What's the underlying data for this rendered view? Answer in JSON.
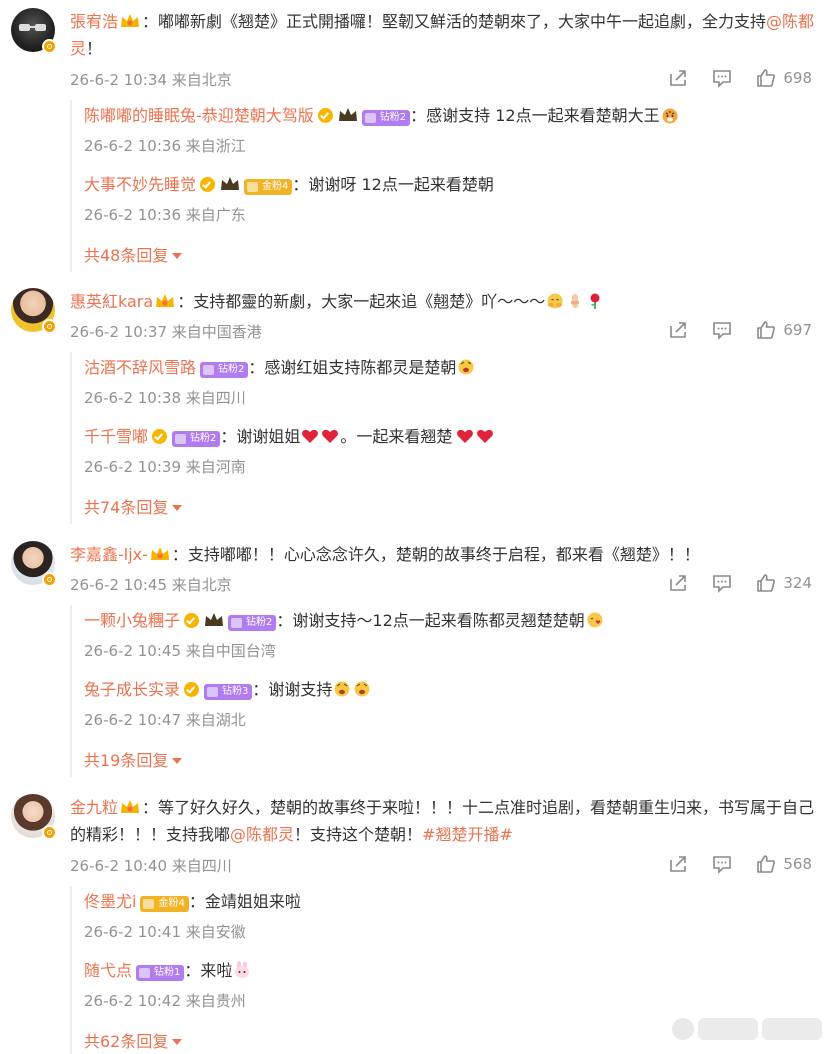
{
  "comments": [
    {
      "user": "張宥浩",
      "text_parts": [
        "：嘟嘟新劇《翘楚》正式開播囉！堅韌又鮮活的楚朝來了，大家中午一起追劇，全力支持",
        "@陈都灵",
        "！"
      ],
      "meta": "26-6-2 10:34 来自北京",
      "likes": "698",
      "replies": [
        {
          "user": "陈嘟嘟的睡眠兔-恭迎楚朝大驾版",
          "badge": "钻粉2",
          "text": "：感谢支持 12点一起来看楚朝大王",
          "meta": "26-6-2 10:36 来自浙江"
        },
        {
          "user": "大事不妙先睡觉",
          "badge": "金粉4",
          "text": "：谢谢呀 12点一起来看楚朝",
          "meta": "26-6-2 10:36 来自广东"
        }
      ],
      "more": "共48条回复"
    },
    {
      "user": "惠英紅kara",
      "text": "：支持都靈的新劇，大家一起來追《翹楚》吖～～～",
      "meta": "26-6-2 10:37 来自中国香港",
      "likes": "697",
      "replies": [
        {
          "user": "沽酒不辞风雪路",
          "badge": "钻粉2",
          "text": "：感谢红姐支持陈都灵是楚朝",
          "meta": "26-6-2 10:38 来自四川"
        },
        {
          "user": "千千雪嘟",
          "badge": "钻粉2",
          "text_a": "：谢谢姐姐",
          "text_b": "。一起来看翘楚",
          "meta": "26-6-2 10:39 来自河南"
        }
      ],
      "more": "共74条回复"
    },
    {
      "user": "李嘉鑫-ljx-",
      "text": "：支持嘟嘟！！心心念念许久，楚朝的故事终于启程，都来看《翘楚》！！",
      "meta": "26-6-2 10:45 来自北京",
      "likes": "324",
      "replies": [
        {
          "user": "一颗小兔糰子",
          "badge": "钻粉2",
          "text": "：谢谢支持～12点一起来看陈都灵翘楚楚朝",
          "meta": "26-6-2 10:45 来自中国台湾"
        },
        {
          "user": "兔子成长实录",
          "badge": "钻粉3",
          "text": "：谢谢支持",
          "meta": "26-6-2 10:47 来自湖北"
        }
      ],
      "more": "共19条回复"
    },
    {
      "user": "金九粒",
      "text_parts": [
        "：等了好久好久，楚朝的故事终于来啦！！！十二点准时追剧，看楚朝重生归来，书写属于自己的精彩！！！支持我嘟",
        "@陈都灵",
        "！支持这个楚朝！",
        "#翘楚开播#"
      ],
      "meta": "26-6-2 10:40 来自四川",
      "likes": "568",
      "replies": [
        {
          "user": "佟墨尤i",
          "badge": "金粉4",
          "text": "：金靖姐姐来啦",
          "meta": "26-6-2 10:41 来自安徽"
        },
        {
          "user": "随弋点",
          "badge": "钻粉1",
          "text": "：来啦",
          "meta": "26-6-2 10:42 来自贵州"
        }
      ],
      "more": "共62条回复"
    }
  ],
  "colors": {
    "name": "#eb7350",
    "meta": "#939393",
    "text": "#333333",
    "vip": "#f7a000",
    "badge_purple": "#b07cf0",
    "badge_gold": "#f2b326"
  },
  "icons": {
    "share": "share-icon",
    "comment": "comment-icon",
    "like": "like-icon",
    "more_caret": "chevron-down-icon"
  }
}
